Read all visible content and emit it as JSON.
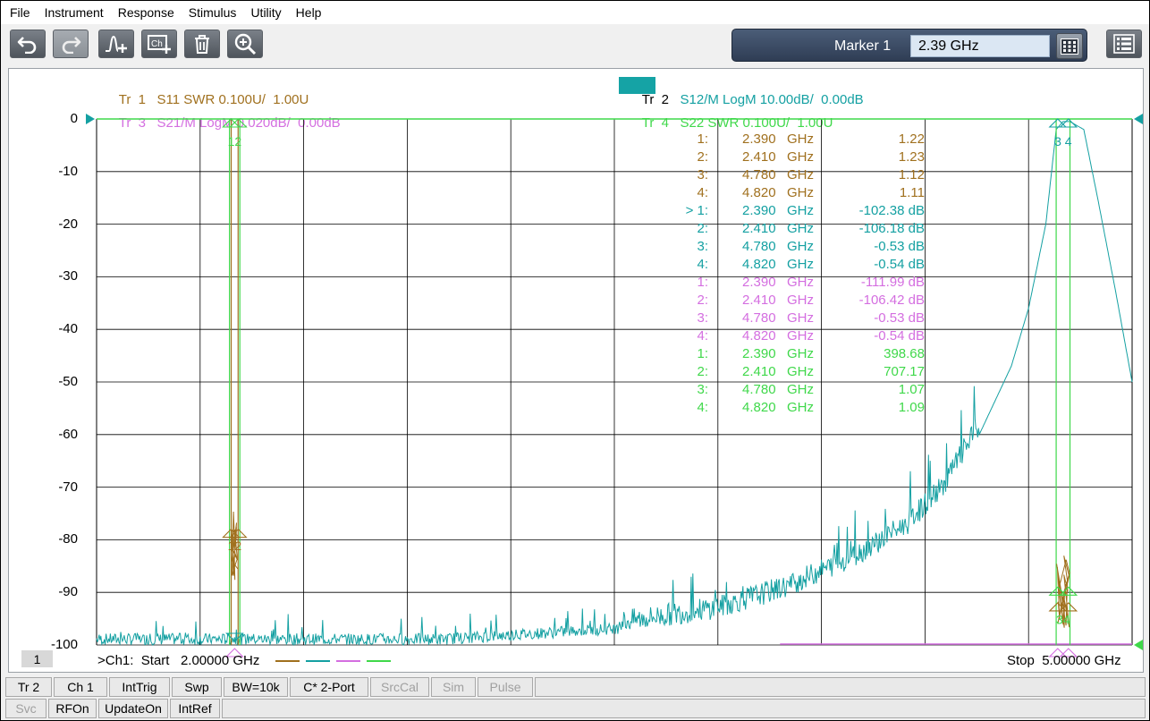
{
  "menu": [
    "File",
    "Instrument",
    "Response",
    "Stimulus",
    "Utility",
    "Help"
  ],
  "toolbar": {
    "icons": [
      "undo-icon",
      "redo-icon",
      "add-trace-icon",
      "add-channel-icon",
      "delete-icon",
      "zoom-icon"
    ],
    "marker_label": "Marker 1",
    "marker_value": "2.39 GHz"
  },
  "traces": {
    "tr1": {
      "label": "Tr  1",
      "desc": "S11 SWR 0.100U/  1.00U",
      "color": "#a0701e"
    },
    "tr2": {
      "label": "Tr  2",
      "desc": "S12/M LogM 10.00dB/  0.00dB",
      "color": "#14a0a2"
    },
    "tr3": {
      "label": "Tr  3",
      "desc": "S21/M LogM 0.020dB/  0.00dB",
      "color": "#d46ee0"
    },
    "tr4": {
      "label": "Tr  4",
      "desc": "S22 SWR 0.100U/  1.00U",
      "color": "#3fd84a"
    }
  },
  "y_axis_labels": [
    "0",
    "-10",
    "-20",
    "-30",
    "-40",
    "-50",
    "-60",
    "-70",
    "-80",
    "-90",
    "-100"
  ],
  "marker_table": [
    {
      "id": "1:",
      "freq": "2.390",
      "unit": "GHz",
      "value": "1.22",
      "trace": "tr1"
    },
    {
      "id": "2:",
      "freq": "2.410",
      "unit": "GHz",
      "value": "1.23",
      "trace": "tr1"
    },
    {
      "id": "3:",
      "freq": "4.780",
      "unit": "GHz",
      "value": "1.12",
      "trace": "tr1"
    },
    {
      "id": "4:",
      "freq": "4.820",
      "unit": "GHz",
      "value": "1.11",
      "trace": "tr1"
    },
    {
      "id": "> 1:",
      "freq": "2.390",
      "unit": "GHz",
      "value": "-102.38 dB",
      "trace": "tr2"
    },
    {
      "id": "2:",
      "freq": "2.410",
      "unit": "GHz",
      "value": "-106.18 dB",
      "trace": "tr2"
    },
    {
      "id": "3:",
      "freq": "4.780",
      "unit": "GHz",
      "value": "-0.53 dB",
      "trace": "tr2"
    },
    {
      "id": "4:",
      "freq": "4.820",
      "unit": "GHz",
      "value": "-0.54 dB",
      "trace": "tr2"
    },
    {
      "id": "1:",
      "freq": "2.390",
      "unit": "GHz",
      "value": "-111.99 dB",
      "trace": "tr3"
    },
    {
      "id": "2:",
      "freq": "2.410",
      "unit": "GHz",
      "value": "-106.42 dB",
      "trace": "tr3"
    },
    {
      "id": "3:",
      "freq": "4.780",
      "unit": "GHz",
      "value": "-0.53 dB",
      "trace": "tr3"
    },
    {
      "id": "4:",
      "freq": "4.820",
      "unit": "GHz",
      "value": "-0.54 dB",
      "trace": "tr3"
    },
    {
      "id": "1:",
      "freq": "2.390",
      "unit": "GHz",
      "value": "398.68",
      "trace": "tr4"
    },
    {
      "id": "2:",
      "freq": "2.410",
      "unit": "GHz",
      "value": "707.17",
      "trace": "tr4"
    },
    {
      "id": "3:",
      "freq": "4.780",
      "unit": "GHz",
      "value": "1.07",
      "trace": "tr4"
    },
    {
      "id": "4:",
      "freq": "4.820",
      "unit": "GHz",
      "value": "1.09",
      "trace": "tr4"
    }
  ],
  "marker_flags": {
    "left_top": "12",
    "left_mid": "12",
    "right_top": "3 4",
    "right_bottom": "34"
  },
  "channel_number": "1",
  "sweep": {
    "start": ">Ch1:  Start   2.00000 GHz",
    "stop": "Stop  5.00000 GHz"
  },
  "status_row1": [
    {
      "label": "Tr 2",
      "enabled": true
    },
    {
      "label": "Ch 1",
      "enabled": true
    },
    {
      "label": "IntTrig",
      "enabled": true
    },
    {
      "label": "Swp",
      "enabled": true
    },
    {
      "label": "BW=10k",
      "enabled": true
    },
    {
      "label": "C* 2-Port",
      "enabled": true
    },
    {
      "label": "SrcCal",
      "enabled": false
    },
    {
      "label": "Sim",
      "enabled": false
    },
    {
      "label": "Pulse",
      "enabled": false
    }
  ],
  "status_row2": [
    {
      "label": "Svc",
      "enabled": false
    },
    {
      "label": "RFOn",
      "enabled": true
    },
    {
      "label": "UpdateOn",
      "enabled": true
    },
    {
      "label": "IntRef",
      "enabled": true
    }
  ],
  "chart_data": {
    "type": "line",
    "x_range_ghz": [
      2.0,
      5.0
    ],
    "y_range_db": [
      -100,
      0
    ],
    "grid": true,
    "series": [
      {
        "name": "S12/M",
        "x": [
          2.0,
          3.0,
          3.5,
          3.8,
          4.0,
          4.2,
          4.35,
          4.45,
          4.55,
          4.65,
          4.7,
          4.75,
          4.78,
          4.8,
          4.82,
          4.86,
          4.9,
          4.95,
          5.0
        ],
        "y": [
          -100,
          -100,
          -98,
          -95,
          -91,
          -85,
          -79,
          -72,
          -61,
          -47,
          -36,
          -20,
          -2,
          -0.5,
          -0.5,
          -2,
          -15,
          -32,
          -50
        ]
      }
    ]
  }
}
